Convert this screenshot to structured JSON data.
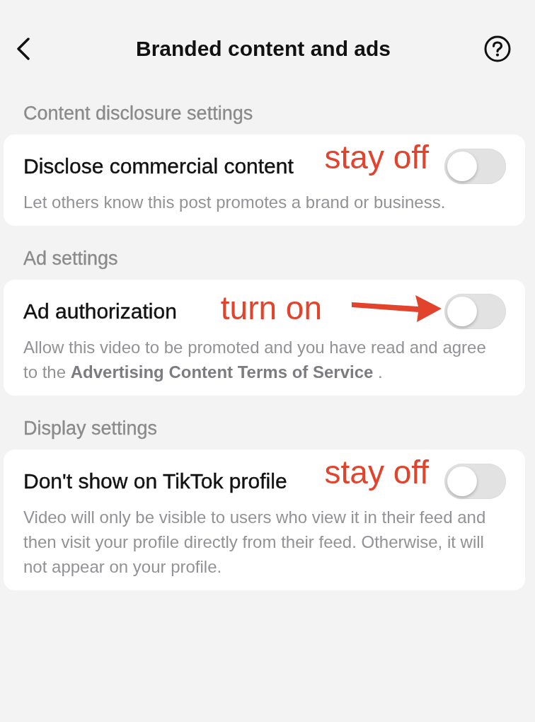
{
  "header": {
    "title": "Branded content and ads"
  },
  "sections": [
    {
      "heading": "Content disclosure settings",
      "setting": {
        "title": "Disclose commercial content",
        "description": "Let others know this post promotes a brand or business.",
        "on": false
      },
      "annotation": {
        "text": "stay off",
        "arrow": false
      }
    },
    {
      "heading": "Ad settings",
      "setting": {
        "title": "Ad authorization",
        "description": "Allow this video to be promoted and you have read and agree to the **Advertising Content Terms of Service** .",
        "on": false
      },
      "annotation": {
        "text": "turn on",
        "arrow": true
      }
    },
    {
      "heading": "Display settings",
      "setting": {
        "title": "Don't show on TikTok profile",
        "description": "Video will only be visible to users who view it in their feed and then visit your profile directly from their feed. Otherwise, it will not appear on your profile.",
        "on": false
      },
      "annotation": {
        "text": "stay off",
        "arrow": false
      }
    }
  ]
}
